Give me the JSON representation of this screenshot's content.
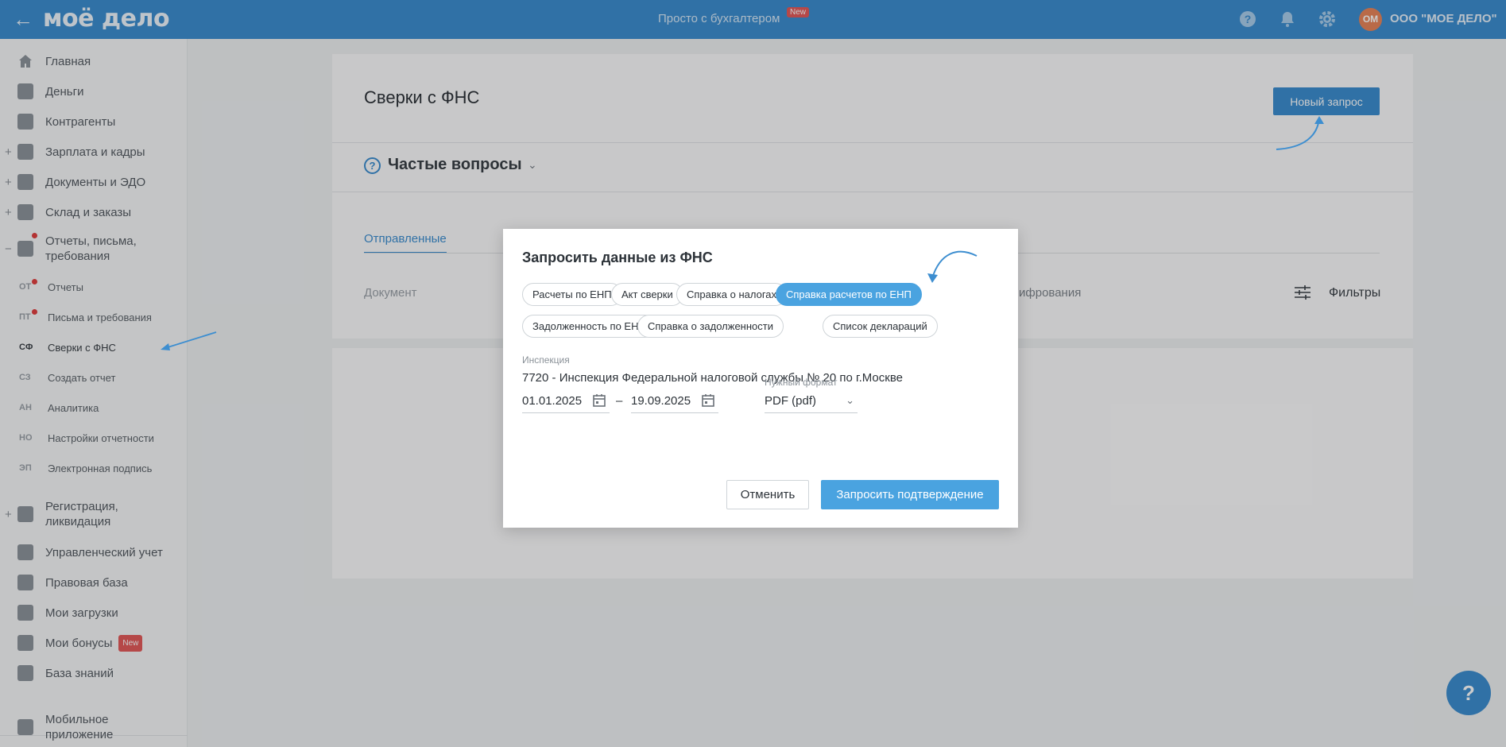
{
  "header": {
    "back_icon": "arrow-left-icon",
    "logo": "моё дело",
    "center_link": "Просто с бухгалтером",
    "center_badge": "New",
    "avatar_initials": "ОМ",
    "company": "ООО \"МОЕ ДЕЛО\""
  },
  "sidebar": {
    "items": [
      {
        "label": "Главная",
        "icon": "home-icon"
      },
      {
        "label": "Деньги",
        "icon": "money-icon"
      },
      {
        "label": "Контрагенты",
        "icon": "contractors-icon"
      },
      {
        "label": "Зарплата и кадры",
        "icon": "salary-icon"
      },
      {
        "label": "Документы и ЭДО",
        "icon": "folder-icon"
      },
      {
        "label": "Склад и заказы",
        "icon": "warehouse-icon"
      },
      {
        "label": "Отчеты, письма, требования",
        "icon": "reports-icon"
      },
      {
        "label": "Регистрация, ликвидация",
        "icon": "registration-icon"
      },
      {
        "label": "Управленческий учет",
        "icon": "management-icon"
      },
      {
        "label": "Правовая база",
        "icon": "briefcase-icon"
      },
      {
        "label": "Мои загрузки",
        "icon": "folder-icon"
      },
      {
        "label": "Мои бонусы",
        "icon": "gift-icon",
        "badge": "New"
      },
      {
        "label": "База знаний",
        "icon": "graduation-icon"
      },
      {
        "label": "Мобильное приложение",
        "icon": "mobile-icon"
      }
    ],
    "subitems": [
      {
        "abbr": "ОТ",
        "label": "Отчеты"
      },
      {
        "abbr": "ПТ",
        "label": "Письма и требования"
      },
      {
        "abbr": "СФ",
        "label": "Сверки с ФНС"
      },
      {
        "abbr": "СЗ",
        "label": "Создать отчет"
      },
      {
        "abbr": "АН",
        "label": "Аналитика"
      },
      {
        "abbr": "НО",
        "label": "Настройки отчетности"
      },
      {
        "abbr": "ЭП",
        "label": "Электронная подпись"
      }
    ]
  },
  "main": {
    "title": "Сверки с ФНС",
    "new_request_button": "Новый запрос",
    "faq_title": "Частые вопросы",
    "tab_sent": "Отправленные",
    "col_document": "Документ",
    "col_encryption": "ифрования",
    "filters_label": "Фильтры"
  },
  "modal": {
    "title": "Запросить данные из ФНС",
    "chips": [
      {
        "label": "Расчеты по ЕНП",
        "active": false
      },
      {
        "label": "Акт сверки",
        "active": false
      },
      {
        "label": "Справка о налогах",
        "active": false
      },
      {
        "label": "Справка расчетов по ЕНП",
        "active": true
      },
      {
        "label": "Задолженность по ЕНП",
        "active": false
      },
      {
        "label": "Справка о задолженности",
        "active": false
      },
      {
        "label": "Список деклараций",
        "active": false
      }
    ],
    "inspection_label": "Инспекция",
    "inspection_value": "7720 - Инспекция Федеральной налоговой службы № 20 по г.Москве",
    "date_from": "01.01.2025",
    "date_to": "19.09.2025",
    "date_separator": "–",
    "format_label": "Нужный формат",
    "format_value": "PDF (pdf)",
    "cancel_button": "Отменить",
    "confirm_button": "Запросить подтверждение"
  },
  "colors": {
    "accent": "#3d8ed0",
    "chip_active": "#4aa3e0",
    "badge_red": "#e35b5b"
  }
}
